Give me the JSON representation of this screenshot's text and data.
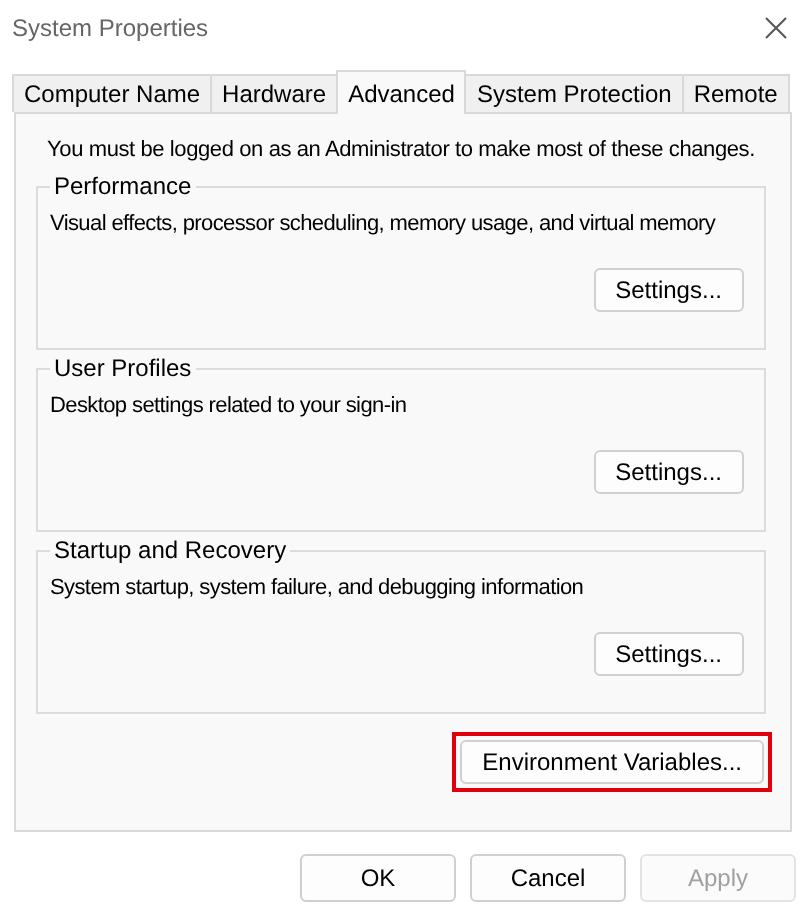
{
  "window": {
    "title": "System Properties"
  },
  "tabs": [
    {
      "label": "Computer Name",
      "selected": false
    },
    {
      "label": "Hardware",
      "selected": false
    },
    {
      "label": "Advanced",
      "selected": true
    },
    {
      "label": "System Protection",
      "selected": false
    },
    {
      "label": "Remote",
      "selected": false
    }
  ],
  "notice": "You must be logged on as an Administrator to make most of these changes.",
  "groups": [
    {
      "title": "Performance",
      "description": "Visual effects, processor scheduling, memory usage, and virtual memory",
      "button": "Settings..."
    },
    {
      "title": "User Profiles",
      "description": "Desktop settings related to your sign-in",
      "button": "Settings..."
    },
    {
      "title": "Startup and Recovery",
      "description": "System startup, system failure, and debugging information",
      "button": "Settings..."
    }
  ],
  "environment_button": {
    "label": "Environment Variables...",
    "highlighted": true
  },
  "buttons": [
    {
      "label": "OK",
      "disabled": false
    },
    {
      "label": "Cancel",
      "disabled": false
    },
    {
      "label": "Apply",
      "disabled": true
    }
  ]
}
